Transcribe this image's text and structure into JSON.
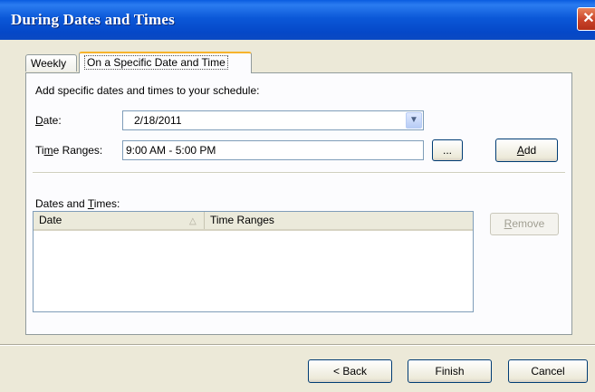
{
  "window": {
    "title": "During Dates and Times",
    "close_glyph": "✕"
  },
  "tabs": [
    {
      "label": "Weekly"
    },
    {
      "label": "On a Specific Date and Time"
    }
  ],
  "panel": {
    "intro": "Add specific dates and times to your schedule:",
    "date_label_accel": "D",
    "date_label_rest": "ate:",
    "date_value": "2/18/2011",
    "time_label_pre": "Ti",
    "time_label_accel": "m",
    "time_label_rest": "e Ranges:",
    "time_value": "9:00 AM - 5:00 PM",
    "ellipsis_label": "...",
    "add_accel": "A",
    "add_rest": "dd",
    "list_label_pre": "Dates and ",
    "list_label_accel": "T",
    "list_label_rest": "imes:",
    "columns": [
      "Date",
      "Time Ranges"
    ],
    "sort_glyph": "△",
    "remove_accel": "R",
    "remove_rest": "emove"
  },
  "footer": {
    "back_label": "< Back",
    "finish_label": "Finish",
    "cancel_label": "Cancel"
  },
  "icons": {
    "dropdown": "chevron-down",
    "close": "close"
  }
}
